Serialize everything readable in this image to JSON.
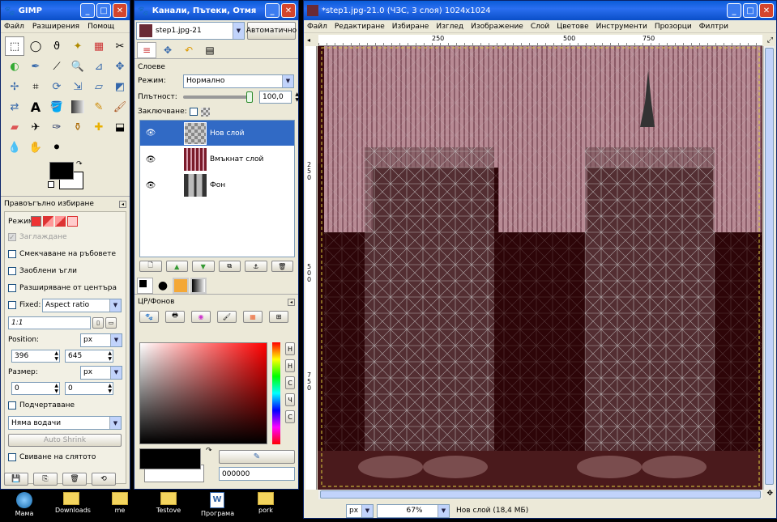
{
  "toolbox": {
    "title": "GIMP",
    "menu": [
      "Файл",
      "Разширения",
      "Помощ"
    ],
    "tool_options_title": "Правоъгълно избиране",
    "mode_label": "Режим:",
    "antialias_label": "Заглаждане",
    "feather_label": "Смекчаване на ръбовете",
    "rounded_label": "Заоблени ъгли",
    "expand_label": "Разширяване от центъра",
    "fixed_label": "Fixed:",
    "fixed_value": "Aspect ratio",
    "ratio_value": "1:1",
    "position_label": "Position:",
    "position_unit": "px",
    "position_x": "396",
    "position_y": "645",
    "size_label": "Размер:",
    "size_unit": "px",
    "size_w": "0",
    "size_h": "0",
    "highlight_label": "Подчертаване",
    "guides_value": "Няма водачи",
    "autoshrink_label": "Auto Shrink",
    "shrink_merged_label": "Свиване на слятото"
  },
  "layers_window": {
    "title": "Канали, Пътеки, Отмя…",
    "image_select": "step1.jpg-21",
    "auto_button": "Автоматично",
    "section_title": "Слоеве",
    "mode_label": "Режим:",
    "mode_value": "Нормално",
    "opacity_label": "Плътност:",
    "opacity_value": "100,0",
    "opacity_fraction": 1.0,
    "lock_label": "Заключване:",
    "layers": [
      {
        "name": "Нов слой"
      },
      {
        "name": "Вмъкнат слой"
      },
      {
        "name": "Фон"
      }
    ],
    "fg_bg_title": "ЦР/Фонов",
    "hex_value": "000000",
    "scale_labels": [
      "Н",
      "Н",
      "С",
      "Ч",
      "С"
    ]
  },
  "image_window": {
    "title": "*step1.jpg-21.0 (ЧЗС, 3 слоя) 1024x1024",
    "menu": [
      "Файл",
      "Редактиране",
      "Избиране",
      "Изглед",
      "Изображение",
      "Слой",
      "Цветове",
      "Инструменти",
      "Прозорци",
      "Филтри"
    ],
    "ruler_h": [
      "250",
      "500",
      "750"
    ],
    "ruler_v": [
      "2",
      "5",
      "0",
      "5",
      "0",
      "0",
      "7",
      "5",
      "0"
    ],
    "unit": "px",
    "zoom": "67%",
    "status": "Нов слой (18,4 МБ)"
  },
  "desktop": {
    "icons": [
      "Мама",
      "Downloads",
      "me",
      "Testove",
      "Програма",
      "pork"
    ]
  }
}
